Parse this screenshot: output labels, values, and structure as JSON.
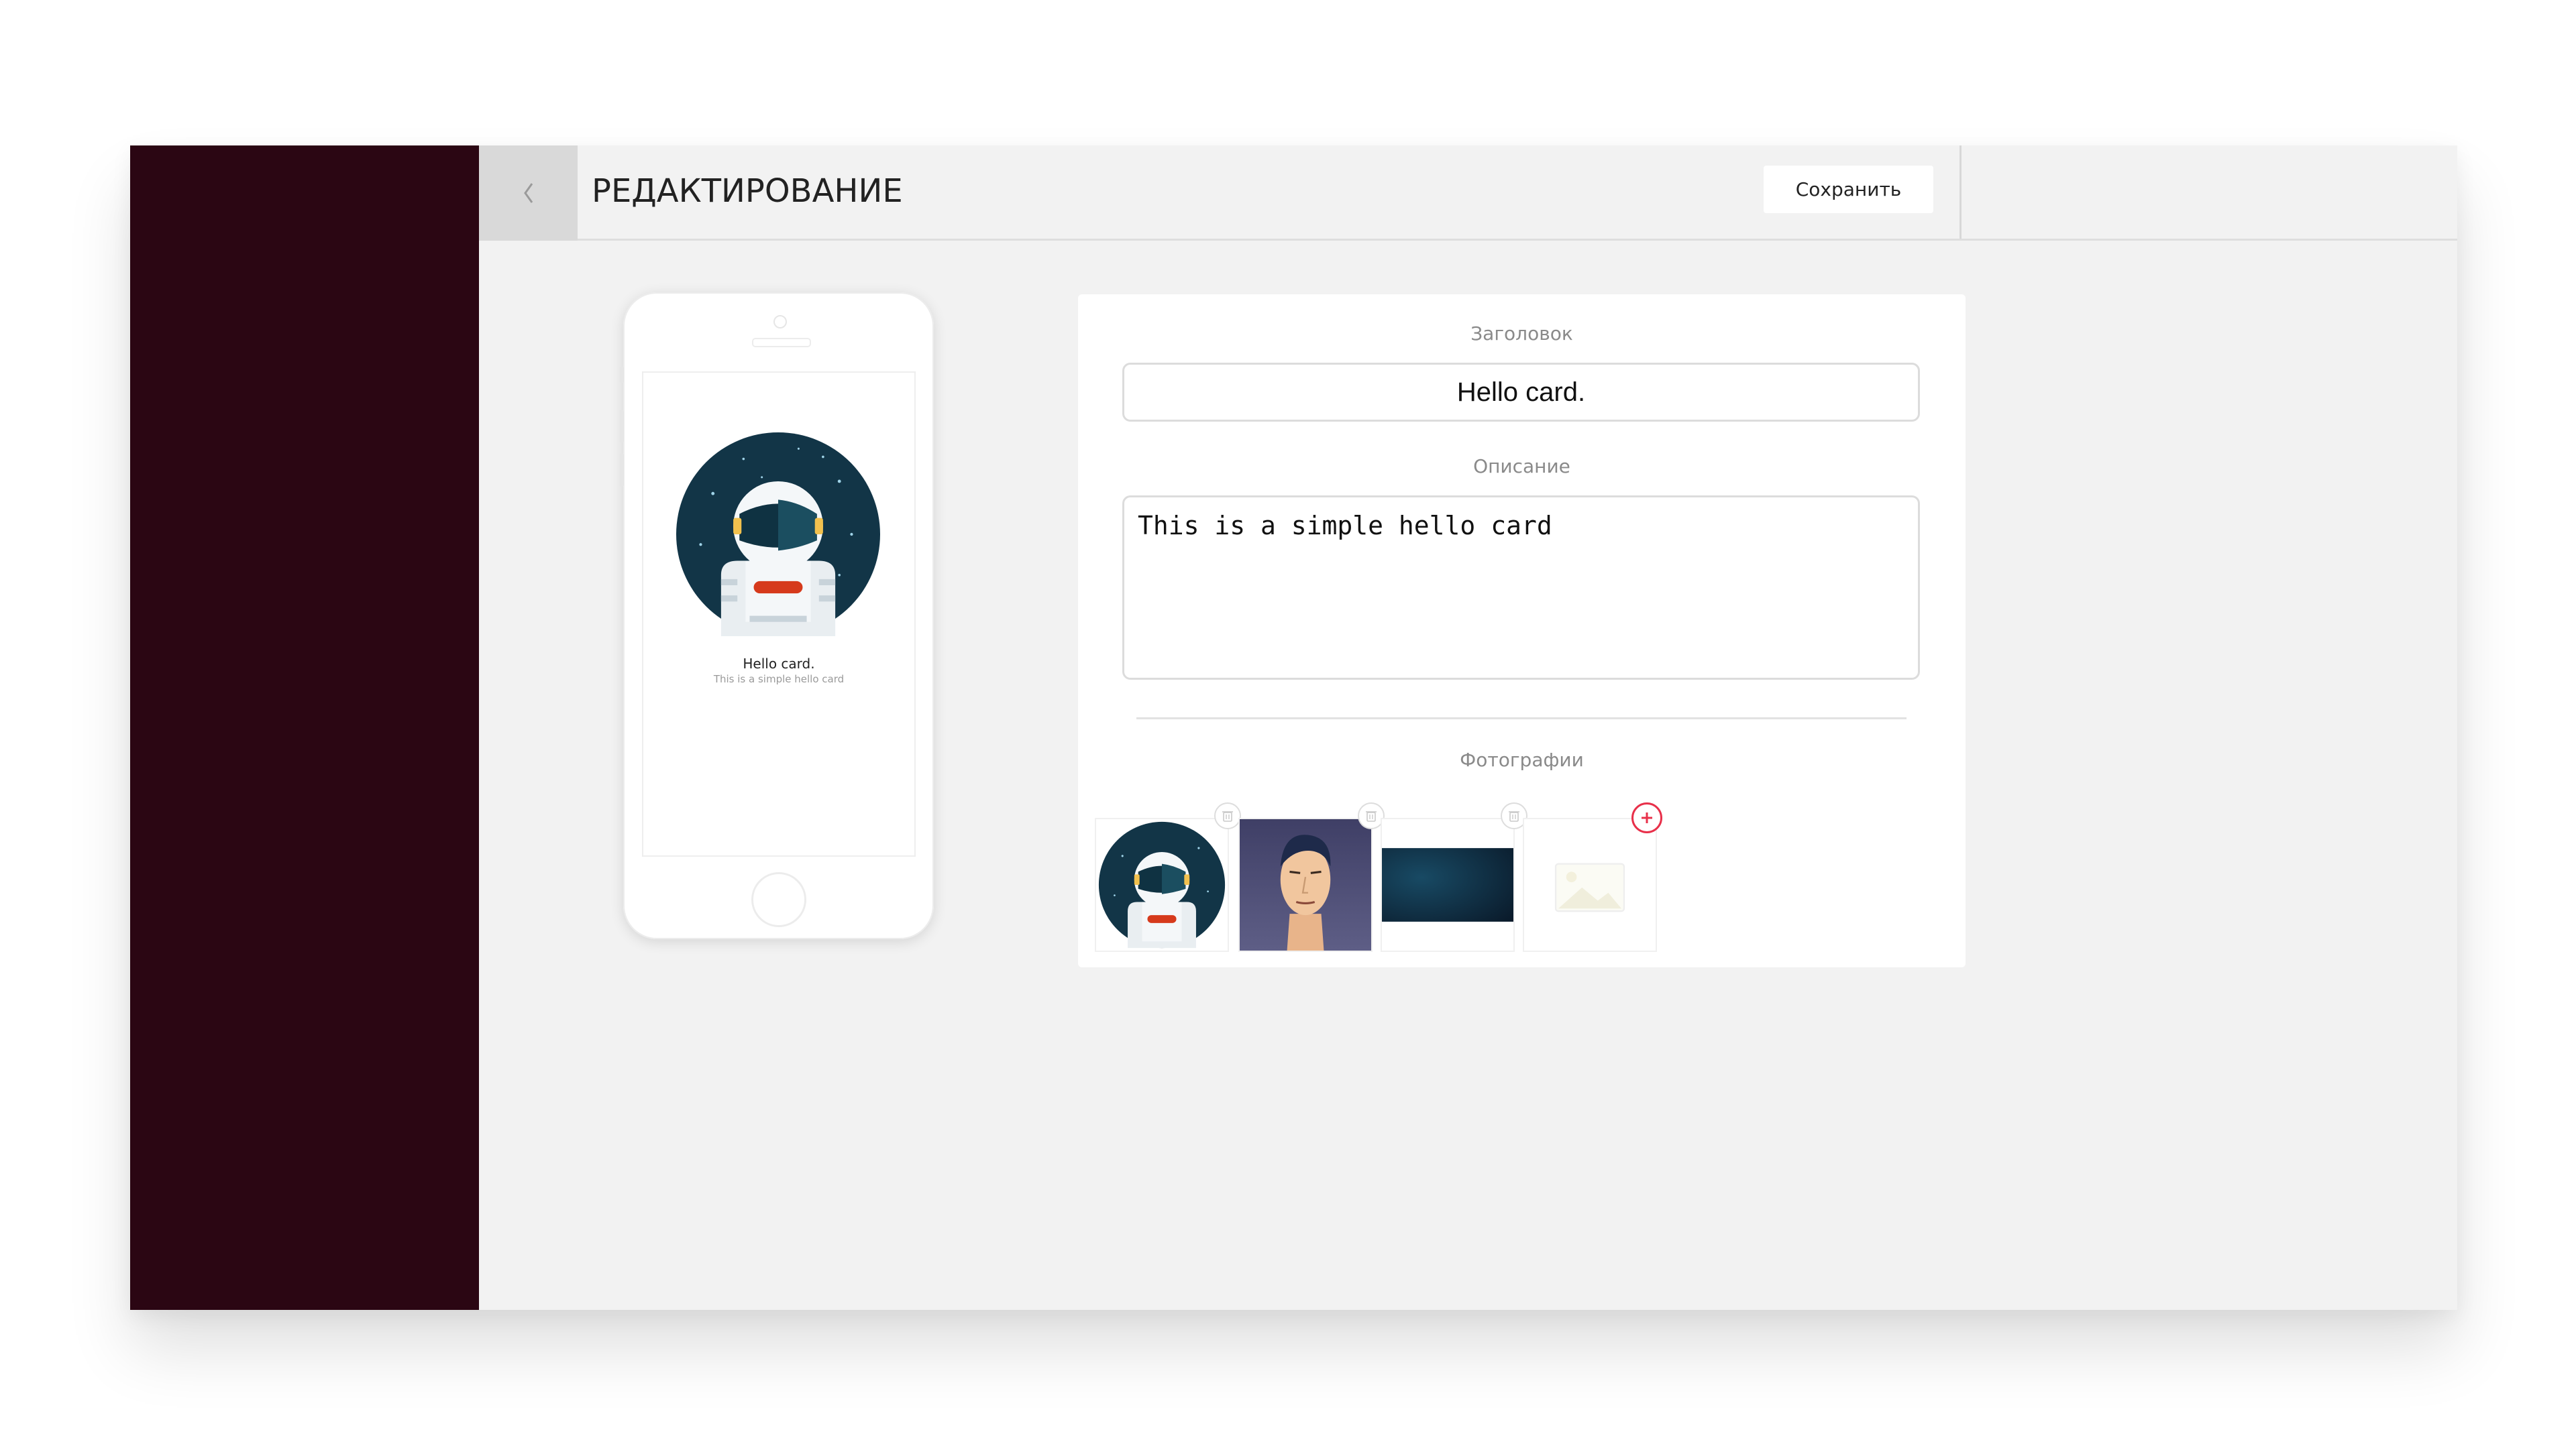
{
  "header": {
    "title": "РЕДАКТИРОВАНИЕ",
    "save_label": "Сохранить"
  },
  "preview": {
    "title": "Hello card.",
    "description": "This is a simple hello card"
  },
  "form": {
    "title_label": "Заголовок",
    "title_value": "Hello card.",
    "description_label": "Описание",
    "description_value": "This is a simple hello card",
    "photos_label": "Фотографии"
  },
  "photos": [
    {
      "kind": "astronaut-avatar",
      "icon": "astronaut-image"
    },
    {
      "kind": "man-portrait",
      "icon": "portrait-image"
    },
    {
      "kind": "dark-blue-banner",
      "icon": "banner-image"
    },
    {
      "kind": "empty-placeholder",
      "icon": "image-placeholder-icon"
    }
  ],
  "colors": {
    "sidebar": "#2b0613",
    "background": "#f2f2f2",
    "accent": "#e8304a",
    "avatar_bg": "#123547"
  }
}
